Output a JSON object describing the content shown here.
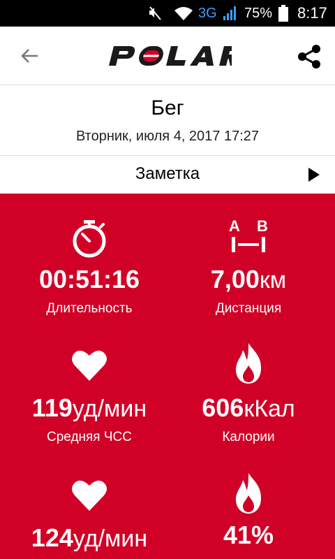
{
  "status_bar": {
    "network": "3G",
    "battery_pct": "75%",
    "time": "8:17"
  },
  "header": {
    "logo_text": "POLAR"
  },
  "workout": {
    "title": "Бег",
    "datetime": "Вторник, июля 4, 2017 17:27"
  },
  "note": {
    "label": "Заметка"
  },
  "stats": [
    {
      "icon": "stopwatch-icon",
      "value": "00:51:16",
      "unit": "",
      "label": "Длительность"
    },
    {
      "icon": "distance-ab-icon",
      "value": "7,00",
      "unit": "км",
      "label": "Дистанция",
      "icon_letters": [
        "A",
        "B"
      ]
    },
    {
      "icon": "heart-icon",
      "value": "119",
      "unit": "уд/мин",
      "label": "Средняя ЧСС"
    },
    {
      "icon": "flame-icon",
      "value": "606",
      "unit": "кКал",
      "label": "Калории"
    },
    {
      "icon": "heart-icon",
      "value": "124",
      "unit": "уд/мин",
      "label": ""
    },
    {
      "icon": "flame-icon",
      "value": "41%",
      "unit": "",
      "label": ""
    }
  ],
  "colors": {
    "accent": "#d10027",
    "brand_logo": "#1a1a1a",
    "logo_o": "#d10027"
  }
}
